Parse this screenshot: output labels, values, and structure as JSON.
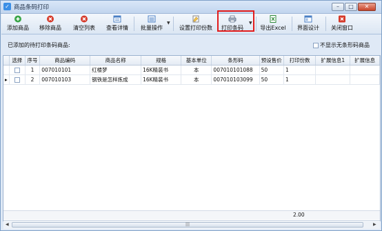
{
  "window": {
    "title": "商品条码打印",
    "app_icon": "✓"
  },
  "toolbar": {
    "buttons": [
      {
        "label": "添加商品",
        "icon": "add-icon",
        "color": "#3aa548"
      },
      {
        "label": "移除商品",
        "icon": "remove-icon",
        "color": "#d63a2a"
      },
      {
        "label": "清空列表",
        "icon": "clear-icon",
        "color": "#d63a2a"
      },
      {
        "label": "查看详情",
        "icon": "details-icon",
        "color": "#4a7fc4"
      },
      {
        "label": "批量操作",
        "icon": "batch-icon",
        "color": "#4a7fc4"
      },
      {
        "label": "设置打印份数",
        "icon": "print-settings-icon",
        "color": "#8a8a8a"
      },
      {
        "label": "打印条码",
        "icon": "printer-icon",
        "color": "#7a8aa0"
      },
      {
        "label": "导出Excel",
        "icon": "excel-icon",
        "color": "#2f8a3a"
      },
      {
        "label": "界面设计",
        "icon": "layout-icon",
        "color": "#4a7fc4"
      },
      {
        "label": "关闭窗口",
        "icon": "close-window-icon",
        "color": "#d63a2a"
      }
    ]
  },
  "info": {
    "label": "已添加的待打印条码商品:",
    "checkbox_label": "不显示无条形码商品"
  },
  "table": {
    "headers": [
      "选择",
      "序号",
      "商品编码",
      "商品名称",
      "规格",
      "基本单位",
      "条形码",
      "预设售价",
      "打印份数",
      "扩展信息1",
      "扩展信息"
    ],
    "rows": [
      [
        "1",
        "007010101",
        "红楼梦",
        "16K精装书",
        "本",
        "007010101088",
        "50",
        "1"
      ],
      [
        "2",
        "007010103",
        "钢铁是怎样炼成",
        "16K精装书",
        "本",
        "007010103099",
        "50",
        "1"
      ]
    ]
  },
  "footer": {
    "total": "2.00"
  }
}
